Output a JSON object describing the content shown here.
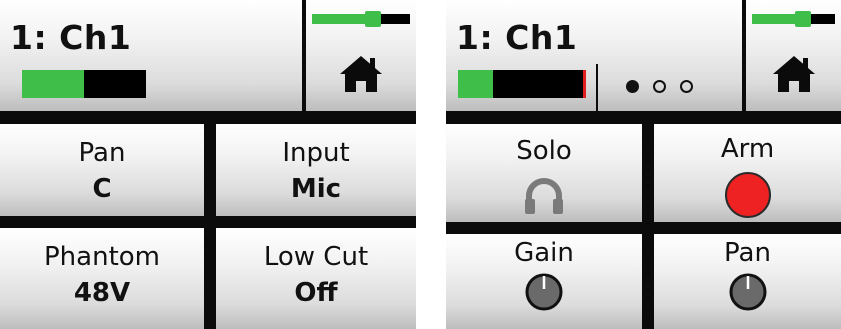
{
  "left_screen": {
    "channel_title": "1: Ch1",
    "input_meter_level": 0.5,
    "master_meter_level": 0.62,
    "cells": [
      {
        "label": "Pan",
        "value": "C"
      },
      {
        "label": "Input",
        "value": "Mic"
      },
      {
        "label": "Phantom",
        "value": "48V"
      },
      {
        "label": "Low Cut",
        "value": "Off"
      }
    ]
  },
  "right_screen": {
    "channel_title": "1: Ch1",
    "input_meter_level": 0.27,
    "master_meter_level": 0.62,
    "page_indicator": {
      "pages": 3,
      "current": 1
    },
    "cells": [
      {
        "label": "Solo",
        "icon": "headphones-icon"
      },
      {
        "label": "Arm",
        "icon": "record-arm-icon"
      },
      {
        "label": "Gain",
        "icon": "knob-icon"
      },
      {
        "label": "Pan",
        "icon": "knob-icon"
      }
    ]
  },
  "colors": {
    "meter_green": "#3fbf4a",
    "arm_red": "#ee2222",
    "peak_red": "#e02020",
    "background": "#0b0b0b"
  }
}
